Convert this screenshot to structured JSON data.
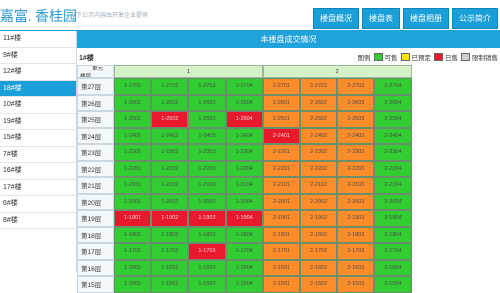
{
  "header": {
    "site_title": "嘉富. 香桂园",
    "subtitle": "以下公示内容由开发企业提供",
    "nav": [
      "楼盘概况",
      "楼盘表",
      "楼盘相册",
      "公示简介"
    ]
  },
  "sidebar": {
    "items": [
      "11#楼",
      "9#楼",
      "12#楼",
      "18#楼",
      "10#楼",
      "19#楼",
      "15#楼",
      "7#楼",
      "16#楼",
      "17#楼",
      "6#楼",
      "8#楼"
    ],
    "active_index": 3
  },
  "panel": {
    "title": "本楼盘成交情况",
    "building": "1#楼",
    "legend_title": "图例",
    "legend": [
      {
        "label": "可售",
        "color": "#32cd32"
      },
      {
        "label": "已预定",
        "color": "#ffe600"
      },
      {
        "label": "已售",
        "color": "#e8192c"
      },
      {
        "label": "限制销售",
        "color": "#cfcfcf"
      }
    ]
  },
  "table": {
    "corner_top": "单元",
    "corner_bottom": "楼层",
    "units": [
      {
        "label": "1",
        "span": 4
      },
      {
        "label": "2",
        "span": 4
      }
    ],
    "rows": [
      {
        "floor": "第27层",
        "cells": [
          [
            "1-2701",
            "g"
          ],
          [
            "1-2702",
            "g"
          ],
          [
            "1-2703",
            "g"
          ],
          [
            "1-2704",
            "g"
          ],
          [
            "2-2701",
            "o"
          ],
          [
            "2-2702",
            "o"
          ],
          [
            "2-2703",
            "o"
          ],
          [
            "2-2704",
            "g"
          ]
        ]
      },
      {
        "floor": "第26层",
        "cells": [
          [
            "1-2601",
            "g"
          ],
          [
            "1-2602",
            "g"
          ],
          [
            "1-2603",
            "g"
          ],
          [
            "1-2604",
            "g"
          ],
          [
            "2-2601",
            "o"
          ],
          [
            "2-2602",
            "o"
          ],
          [
            "2-2603",
            "o"
          ],
          [
            "2-2604",
            "g"
          ]
        ]
      },
      {
        "floor": "第25层",
        "cells": [
          [
            "1-2501",
            "g"
          ],
          [
            "1-2502",
            "r"
          ],
          [
            "1-2503",
            "g"
          ],
          [
            "1-2504",
            "r"
          ],
          [
            "2-2501",
            "o"
          ],
          [
            "2-2502",
            "o"
          ],
          [
            "2-2503",
            "o"
          ],
          [
            "2-2504",
            "g"
          ]
        ]
      },
      {
        "floor": "第24层",
        "cells": [
          [
            "1-2401",
            "g"
          ],
          [
            "1-2402",
            "g"
          ],
          [
            "1-2403",
            "g"
          ],
          [
            "1-2404",
            "g"
          ],
          [
            "2-2401",
            "r"
          ],
          [
            "2-2402",
            "o"
          ],
          [
            "2-2403",
            "o"
          ],
          [
            "2-2404",
            "g"
          ]
        ]
      },
      {
        "floor": "第23层",
        "cells": [
          [
            "1-2301",
            "g"
          ],
          [
            "1-2302",
            "g"
          ],
          [
            "1-2303",
            "g"
          ],
          [
            "1-2304",
            "g"
          ],
          [
            "2-2301",
            "o"
          ],
          [
            "2-2302",
            "o"
          ],
          [
            "2-2303",
            "o"
          ],
          [
            "2-2304",
            "g"
          ]
        ]
      },
      {
        "floor": "第22层",
        "cells": [
          [
            "1-2201",
            "g"
          ],
          [
            "1-2202",
            "g"
          ],
          [
            "1-2203",
            "g"
          ],
          [
            "1-2204",
            "g"
          ],
          [
            "2-2201",
            "o"
          ],
          [
            "2-2202",
            "o"
          ],
          [
            "2-2203",
            "o"
          ],
          [
            "2-2204",
            "g"
          ]
        ]
      },
      {
        "floor": "第21层",
        "cells": [
          [
            "1-2101",
            "g"
          ],
          [
            "1-2102",
            "g"
          ],
          [
            "1-2103",
            "g"
          ],
          [
            "1-2104",
            "g"
          ],
          [
            "2-2101",
            "o"
          ],
          [
            "2-2102",
            "o"
          ],
          [
            "2-2103",
            "o"
          ],
          [
            "2-2104",
            "g"
          ]
        ]
      },
      {
        "floor": "第20层",
        "cells": [
          [
            "1-2001",
            "g"
          ],
          [
            "1-2002",
            "g"
          ],
          [
            "1-2003",
            "g"
          ],
          [
            "1-2004",
            "g"
          ],
          [
            "2-2001",
            "o"
          ],
          [
            "2-2002",
            "o"
          ],
          [
            "2-2003",
            "o"
          ],
          [
            "2-2004",
            "g"
          ]
        ]
      },
      {
        "floor": "第19层",
        "cells": [
          [
            "1-1901",
            "r"
          ],
          [
            "1-1902",
            "r"
          ],
          [
            "1-1903",
            "r"
          ],
          [
            "1-1904",
            "r"
          ],
          [
            "2-1901",
            "o"
          ],
          [
            "2-1902",
            "o"
          ],
          [
            "2-1903",
            "o"
          ],
          [
            "2-1904",
            "g"
          ]
        ]
      },
      {
        "floor": "第18层",
        "cells": [
          [
            "1-1801",
            "g"
          ],
          [
            "1-1802",
            "g"
          ],
          [
            "1-1803",
            "g"
          ],
          [
            "1-1804",
            "g"
          ],
          [
            "2-1801",
            "o"
          ],
          [
            "2-1802",
            "o"
          ],
          [
            "2-1803",
            "o"
          ],
          [
            "2-1804",
            "g"
          ]
        ]
      },
      {
        "floor": "第17层",
        "cells": [
          [
            "1-1701",
            "g"
          ],
          [
            "1-1702",
            "g"
          ],
          [
            "1-1703",
            "r"
          ],
          [
            "1-1704",
            "g"
          ],
          [
            "2-1701",
            "o"
          ],
          [
            "2-1702",
            "o"
          ],
          [
            "2-1703",
            "o"
          ],
          [
            "2-1704",
            "g"
          ]
        ]
      },
      {
        "floor": "第16层",
        "cells": [
          [
            "1-1601",
            "g"
          ],
          [
            "1-1602",
            "g"
          ],
          [
            "1-1603",
            "g"
          ],
          [
            "1-1604",
            "g"
          ],
          [
            "2-1601",
            "o"
          ],
          [
            "2-1602",
            "o"
          ],
          [
            "2-1603",
            "o"
          ],
          [
            "2-1604",
            "g"
          ]
        ]
      },
      {
        "floor": "第15层",
        "cells": [
          [
            "1-1501",
            "g"
          ],
          [
            "1-1502",
            "g"
          ],
          [
            "1-1503",
            "g"
          ],
          [
            "1-1504",
            "g"
          ],
          [
            "2-1501",
            "o"
          ],
          [
            "2-1502",
            "o"
          ],
          [
            "2-1503",
            "o"
          ],
          [
            "2-1504",
            "g"
          ]
        ]
      }
    ]
  }
}
